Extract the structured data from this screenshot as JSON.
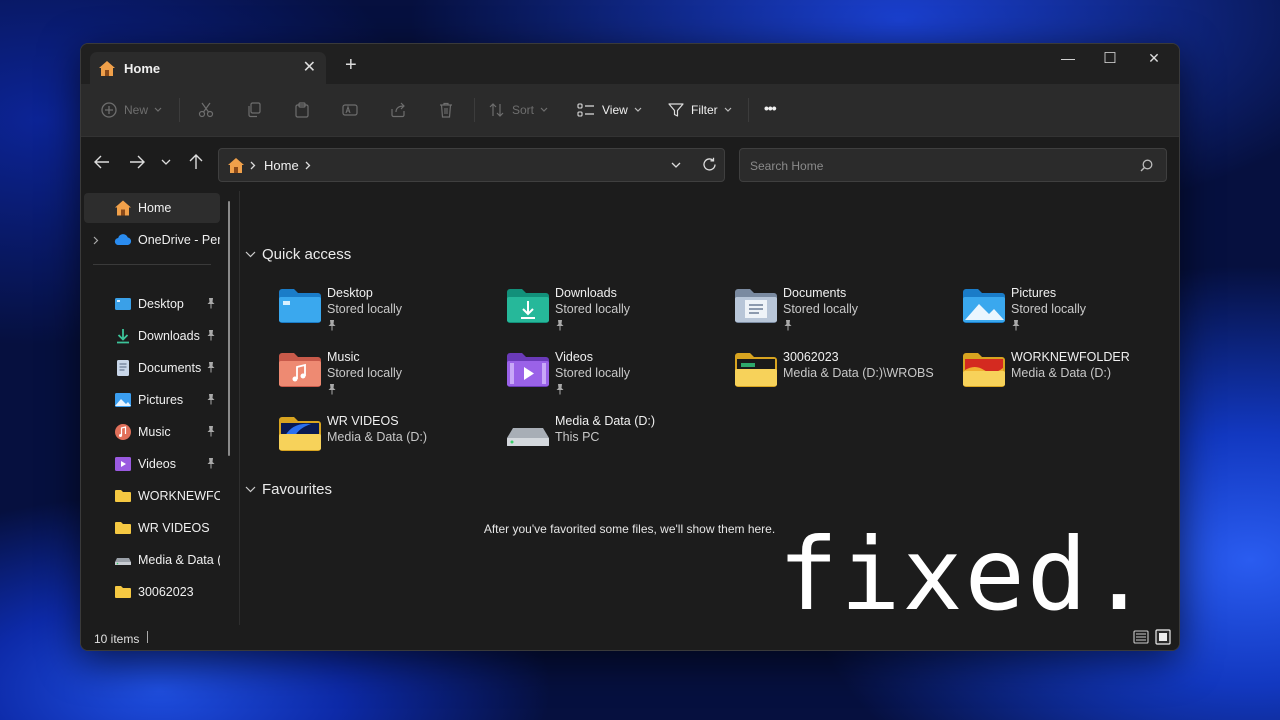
{
  "titlebar": {
    "tab_label": "Home",
    "tab_close": "✕",
    "new_tab": "+",
    "minimize": "—",
    "maximize": "☐",
    "close": "✕"
  },
  "toolbar": {
    "new_label": "New",
    "sort_label": "Sort",
    "view_label": "View",
    "filter_label": "Filter",
    "more_label": "•••"
  },
  "address": {
    "crumb": "Home",
    "search_placeholder": "Search Home"
  },
  "sidebar": {
    "items": [
      {
        "label": "Home",
        "icon": "home-icon"
      },
      {
        "label": "OneDrive - Personal",
        "icon": "cloud-icon"
      },
      {
        "label": "Desktop",
        "icon": "desktop-icon",
        "pinned": true
      },
      {
        "label": "Downloads",
        "icon": "download-icon",
        "pinned": true
      },
      {
        "label": "Documents",
        "icon": "document-icon",
        "pinned": true
      },
      {
        "label": "Pictures",
        "icon": "pictures-icon",
        "pinned": true
      },
      {
        "label": "Music",
        "icon": "music-icon",
        "pinned": true
      },
      {
        "label": "Videos",
        "icon": "video-icon",
        "pinned": true
      },
      {
        "label": "WORKNEWFOLDER",
        "icon": "folder-icon"
      },
      {
        "label": "WR VIDEOS",
        "icon": "folder-icon"
      },
      {
        "label": "Media & Data (D:)",
        "icon": "drive-icon"
      },
      {
        "label": "30062023",
        "icon": "folder-icon"
      }
    ]
  },
  "main": {
    "quick_access_title": "Quick access",
    "favourites_title": "Favourites",
    "favourites_empty": "After you've favorited some files, we'll show them here.",
    "items": [
      {
        "name": "Desktop",
        "sub": "Stored locally",
        "pinned": true
      },
      {
        "name": "Downloads",
        "sub": "Stored locally",
        "pinned": true
      },
      {
        "name": "Documents",
        "sub": "Stored locally",
        "pinned": true
      },
      {
        "name": "Pictures",
        "sub": "Stored locally",
        "pinned": true
      },
      {
        "name": "Music",
        "sub": "Stored locally",
        "pinned": true
      },
      {
        "name": "Videos",
        "sub": "Stored locally",
        "pinned": true
      },
      {
        "name": "30062023",
        "sub": "Media & Data (D:)\\WROBS"
      },
      {
        "name": "WORKNEWFOLDER",
        "sub": "Media & Data (D:)"
      },
      {
        "name": "WR VIDEOS",
        "sub": "Media & Data (D:)"
      },
      {
        "name": "Media & Data (D:)",
        "sub": "This PC"
      }
    ]
  },
  "status": {
    "count": "10 items"
  },
  "overlay_text": "fixed."
}
